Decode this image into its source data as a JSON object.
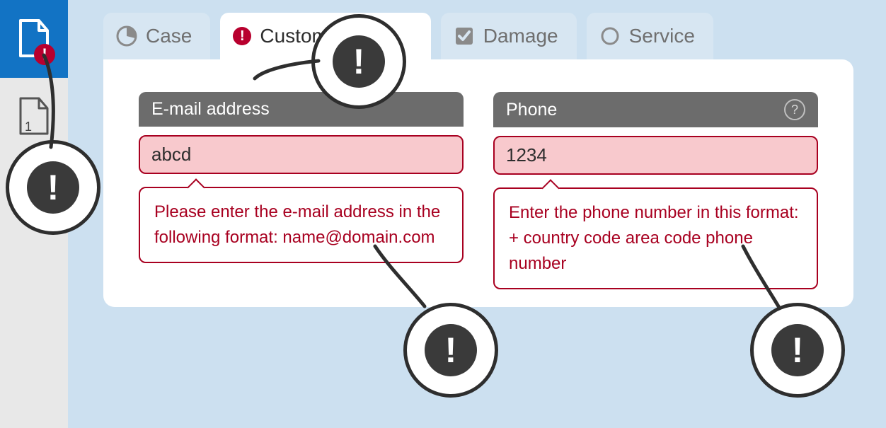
{
  "sidebar": {
    "items": [
      {
        "name": "active-document",
        "has_error": true
      },
      {
        "name": "document-1",
        "number": "1"
      }
    ]
  },
  "tabs": [
    {
      "id": "case",
      "label": "Case",
      "icon": "pie",
      "active": false
    },
    {
      "id": "customer",
      "label": "Customer",
      "icon": "error",
      "active": true
    },
    {
      "id": "damage",
      "label": "Damage",
      "icon": "check",
      "active": false
    },
    {
      "id": "service",
      "label": "Service",
      "icon": "circle",
      "active": false
    }
  ],
  "form": {
    "email": {
      "label": "E-mail address",
      "value": "abcd",
      "error": "Please enter the e-mail address in the following format: name@domain.com"
    },
    "phone": {
      "label": "Phone",
      "value": "1234",
      "has_help": true,
      "error": "Enter the phone number in this format: + country code area code phone number"
    }
  },
  "annotations": {
    "icon": "exclamation"
  },
  "colors": {
    "error": "#a80020",
    "error_bg": "#f8c9cd",
    "accent": "#1273c4"
  }
}
